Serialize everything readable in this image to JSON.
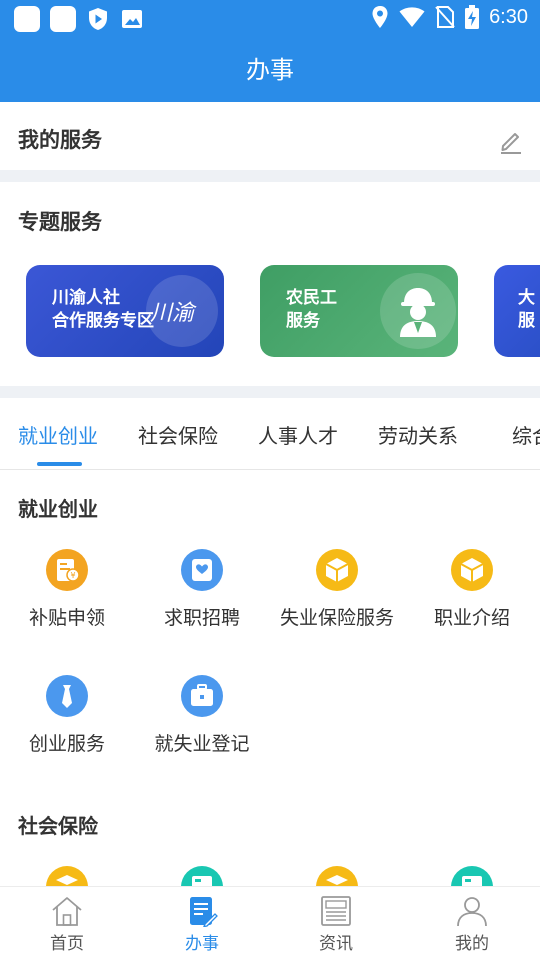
{
  "status_bar": {
    "time": "6:30",
    "left_icons": [
      "app-square-icon",
      "app-square-icon",
      "shield-play-icon",
      "image-icon"
    ],
    "right_icons": [
      "location-icon",
      "wifi-icon",
      "no-sim-icon",
      "battery-charging-icon"
    ]
  },
  "header": {
    "title": "办事"
  },
  "my_service": {
    "label": "我的服务",
    "edit_icon": "edit-pencil-icon"
  },
  "special_services": {
    "label": "专题服务",
    "cards": [
      {
        "line1": "川渝人社",
        "line2": "合作服务专区",
        "badge": "川渝"
      },
      {
        "line1": "农民工",
        "line2": "服务"
      },
      {
        "line1": "大",
        "line2": "服"
      }
    ]
  },
  "tabs": [
    "就业创业",
    "社会保险",
    "人事人才",
    "劳动关系",
    "综合"
  ],
  "active_tab": 0,
  "sections": [
    {
      "title": "就业创业",
      "items": [
        {
          "label": "补贴申领",
          "icon": "subsidy-icon",
          "color": "#f3a421"
        },
        {
          "label": "求职招聘",
          "icon": "resume-heart-icon",
          "color": "#4b98ee"
        },
        {
          "label": "失业保险服务",
          "icon": "box-icon",
          "color": "#f6ba16"
        },
        {
          "label": "职业介绍",
          "icon": "box-icon",
          "color": "#f6ba16"
        },
        {
          "label": "创业服务",
          "icon": "tie-icon",
          "color": "#4b98ee"
        },
        {
          "label": "就失业登记",
          "icon": "briefcase-icon",
          "color": "#4b98ee"
        }
      ]
    },
    {
      "title": "社会保险"
    }
  ],
  "bottom_nav": [
    {
      "label": "首页",
      "icon": "home-icon"
    },
    {
      "label": "办事",
      "icon": "document-pen-icon"
    },
    {
      "label": "资讯",
      "icon": "news-icon"
    },
    {
      "label": "我的",
      "icon": "user-icon"
    }
  ],
  "active_nav": 1,
  "colors": {
    "primary": "#2a8ce8",
    "background_gap": "#eef1f5"
  }
}
